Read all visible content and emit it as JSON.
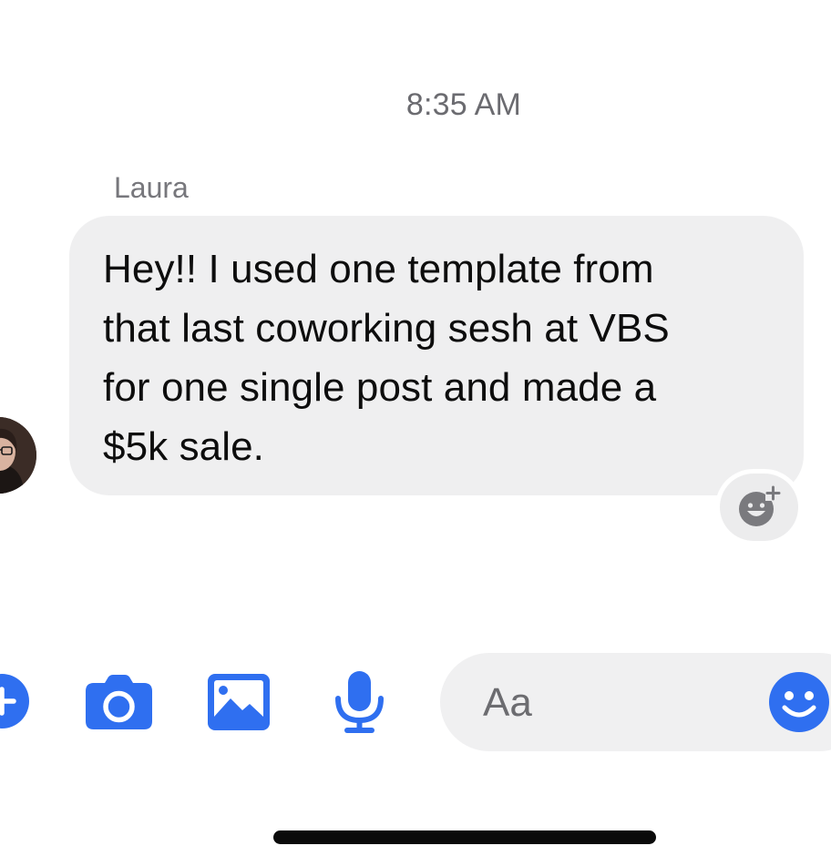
{
  "thread": {
    "timestamp": "8:35 AM",
    "messages": [
      {
        "sender": "Laura",
        "text": "Hey!! I used one template from\nthat last coworking sesh at VBS\nfor one single post and made a\n$5k sale."
      }
    ]
  },
  "composer": {
    "placeholder": "Aa",
    "icons": [
      "plus-icon",
      "camera-icon",
      "image-icon",
      "microphone-icon",
      "emoji-icon"
    ]
  },
  "colors": {
    "accent": "#2f6ff0",
    "bubble": "#efeff0",
    "timestamp": "#6b6b70"
  }
}
